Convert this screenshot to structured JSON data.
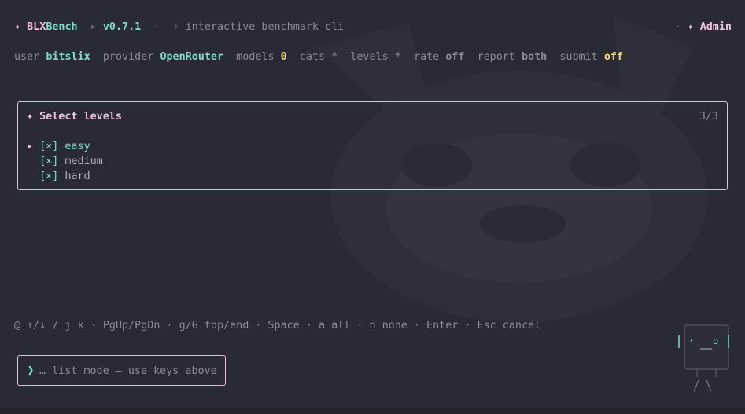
{
  "header": {
    "star": "✦",
    "brand_a": "BLX",
    "brand_b": "Bench",
    "sep1": "▸",
    "version": "v0.7.1",
    "sep2": "·",
    "sep3": "›",
    "tagline": "interactive benchmark cli",
    "right_sep": "·",
    "right_star": "✦",
    "user_role": "Admin"
  },
  "status": {
    "user_label": "user",
    "user_value": "bitslix",
    "provider_label": "provider",
    "provider_value": "OpenRouter",
    "models_label": "models",
    "models_value": "0",
    "cats_label": "cats",
    "cats_value": "*",
    "levels_label": "levels",
    "levels_value": "*",
    "rate_label": "rate",
    "rate_value": "off",
    "report_label": "report",
    "report_value": "both",
    "submit_label": "submit",
    "submit_value": "off"
  },
  "selector": {
    "star": "✦",
    "title": "Select levels",
    "count": "3/3",
    "cursor": "▸",
    "items": [
      {
        "check": "[×]",
        "label": "easy"
      },
      {
        "check": "[×]",
        "label": "medium"
      },
      {
        "check": "[×]",
        "label": "hard"
      }
    ]
  },
  "hint": "@ ↑/↓ / j k · PgUp/PgDn · g/G top/end · Space · a all · n none · Enter · Esc cancel",
  "input": {
    "prompt": "❱",
    "placeholder": "… list mode — use keys above"
  },
  "mascot": {
    "eyes": "·",
    "eye_right": "o"
  },
  "colors": {
    "background": "#2a2a36",
    "accent_pink": "#ecc3da",
    "accent_teal": "#7fdcc9",
    "value_yellow": "#f1d787"
  }
}
